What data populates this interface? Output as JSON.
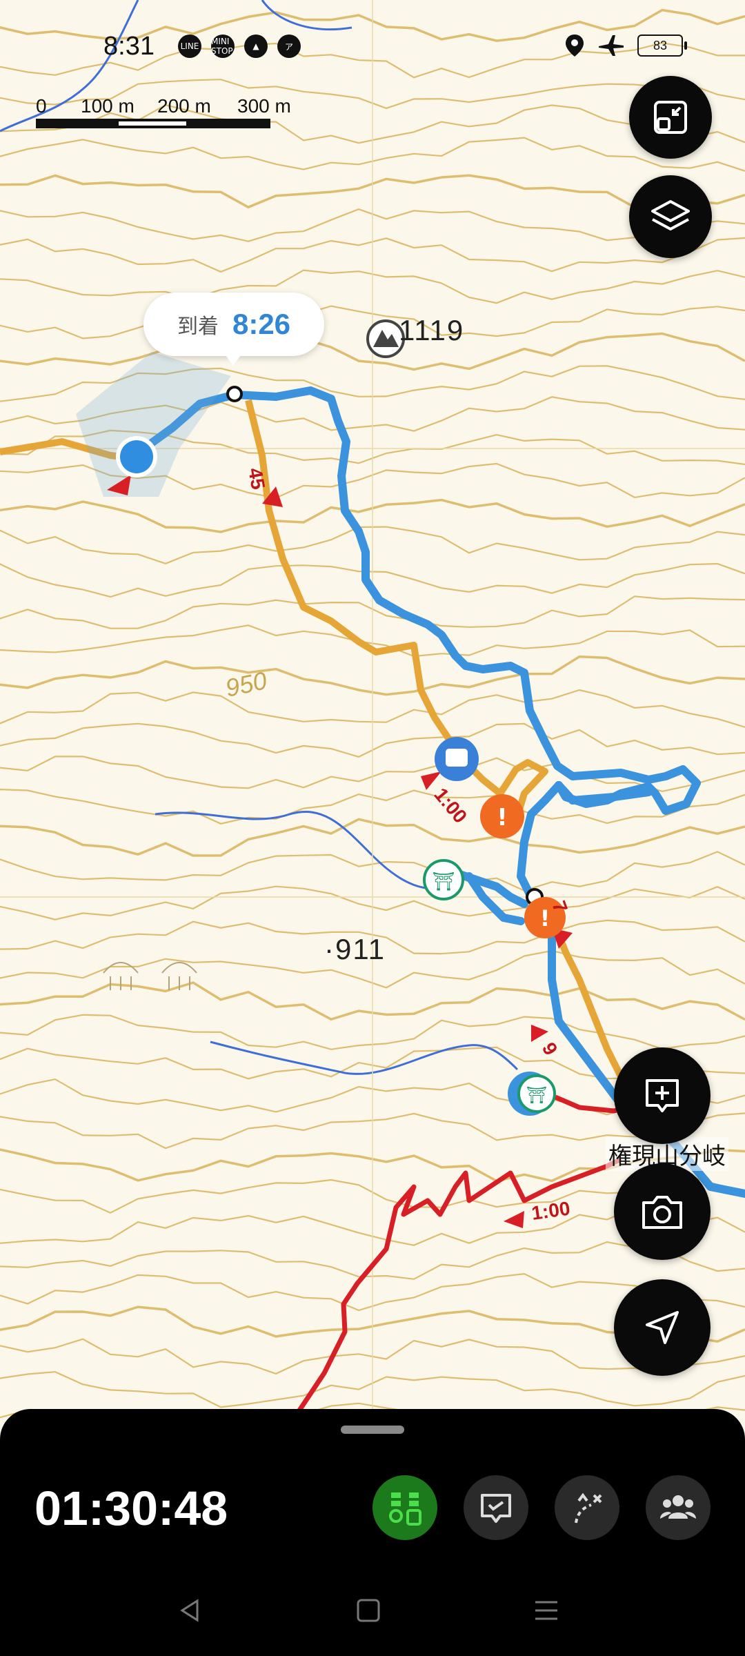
{
  "status_bar": {
    "time": "8:31",
    "notification_icons": [
      "LINE",
      "MINI STOP",
      "▲",
      "ア"
    ],
    "battery": "83"
  },
  "scale_bar": {
    "labels": [
      "0",
      "100 m",
      "200 m",
      "300 m"
    ]
  },
  "callout": {
    "label": "到着",
    "time": "8:26"
  },
  "map_labels": {
    "peak_elevation": "1119",
    "spot_elevation": "·911",
    "contour_label": "950",
    "junction_name": "権現山分岐"
  },
  "course_times": {
    "orange_segment": "45",
    "red_segment_mid": "1:00",
    "blue_segment": "9",
    "red_segment_low": "1:00",
    "orange_short": "7"
  },
  "colors": {
    "route_blue": "#3a93dc",
    "course_orange": "#e6a637",
    "course_red": "#d81f26",
    "contour": "#d9b45a",
    "stream": "#3f6fd6",
    "sheet_bg": "#000000",
    "active_green": "#1c7a1c",
    "callout_time": "#2f86d6"
  },
  "bottom_sheet": {
    "elapsed_time": "01:30:48",
    "tools": [
      "route-progress",
      "message",
      "route-off",
      "group"
    ]
  },
  "icons": {
    "fab_expand": "expand-icon",
    "fab_layers": "layers-icon",
    "fab_add_note": "add-note-icon",
    "fab_camera": "camera-icon",
    "fab_locate": "navigation-icon"
  }
}
